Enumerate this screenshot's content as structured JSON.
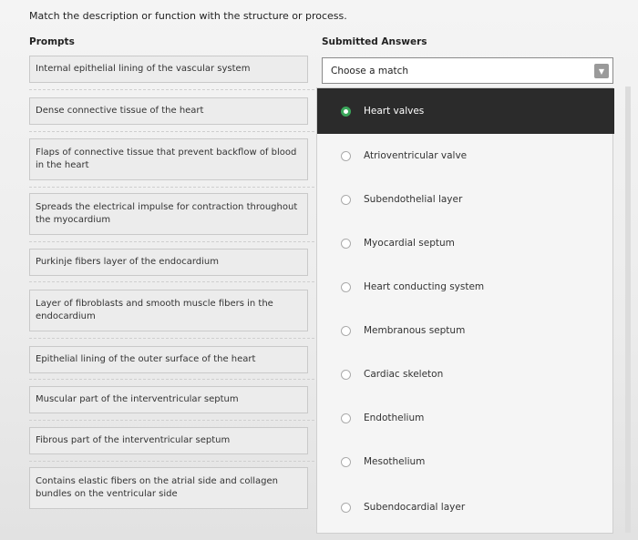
{
  "instruction": "Match the description or function with the structure or process.",
  "headers": {
    "prompts": "Prompts",
    "answers": "Submitted Answers"
  },
  "prompts": [
    "Internal epithelial lining of the vascular system",
    "Dense connective tissue of the heart",
    "Flaps of connective tissue that prevent backflow of blood in the heart",
    "Spreads the electrical impulse for contraction throughout the myocardium",
    "Purkinje fibers layer of the endocardium",
    "Layer of fibroblasts and smooth muscle fibers in the endocardium",
    "Epithelial lining of the outer surface of the heart",
    "Muscular part of the interventricular septum",
    "Fibrous part of the interventricular septum",
    "Contains elastic fibers on the atrial side and collagen bundles on the ventricular side"
  ],
  "select": {
    "value": "Choose a match"
  },
  "options": [
    "Heart valves",
    "Atrioventricular valve",
    "Subendothelial layer",
    "Myocardial septum",
    "Heart conducting system",
    "Membranous septum",
    "Cardiac skeleton",
    "Endothelium",
    "Mesothelium",
    "Subendocardial layer"
  ],
  "selected_option": "Heart valves",
  "colors": {
    "accent": "#3aa65a",
    "highlight": "#2b2b2b"
  },
  "icons": {
    "caret": "chevron-down-icon",
    "cursor": "hand-cursor-icon"
  }
}
